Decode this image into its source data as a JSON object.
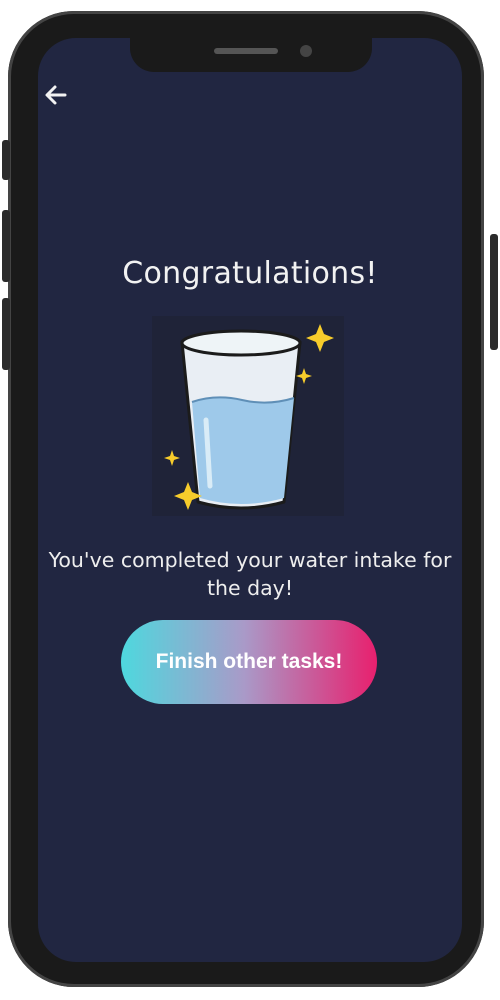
{
  "screen": {
    "title": "Congratulations!",
    "message": "You've completed your water intake for the day!",
    "cta_label": "Finish other tasks!"
  },
  "icons": {
    "back": "arrow-left-icon",
    "illustration": "water-glass-icon",
    "sparkles": "sparkle-icon"
  },
  "colors": {
    "background": "#212641",
    "text": "#f2f2f2",
    "gradient_start": "#4ed8de",
    "gradient_end": "#e8206e",
    "water": "#9ec9ea",
    "sparkle": "#f7cc2b"
  }
}
